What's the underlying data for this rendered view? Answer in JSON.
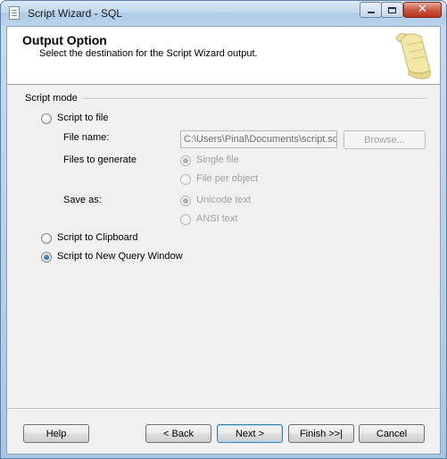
{
  "window": {
    "title": "Script Wizard - SQL"
  },
  "header": {
    "title": "Output Option",
    "subtitle": "Select the destination for the Script Wizard output."
  },
  "script_mode": {
    "group_label": "Script mode",
    "options": {
      "to_file": "Script to file",
      "to_clipboard": "Script to Clipboard",
      "to_query_window": "Script to New Query Window"
    },
    "selected": "to_query_window",
    "file_name_label": "File name:",
    "file_name_value": "C:\\Users\\Pinal\\Documents\\script.sql",
    "browse_label": "Browse...",
    "files_to_generate_label": "Files to generate",
    "single_file": "Single file",
    "file_per_object": "File per object",
    "save_as_label": "Save as:",
    "unicode_text": "Unicode text",
    "ansi_text": "ANSI text"
  },
  "footer": {
    "help": "Help",
    "back": "< Back",
    "next": "Next >",
    "finish": "Finish >>|",
    "cancel": "Cancel"
  }
}
